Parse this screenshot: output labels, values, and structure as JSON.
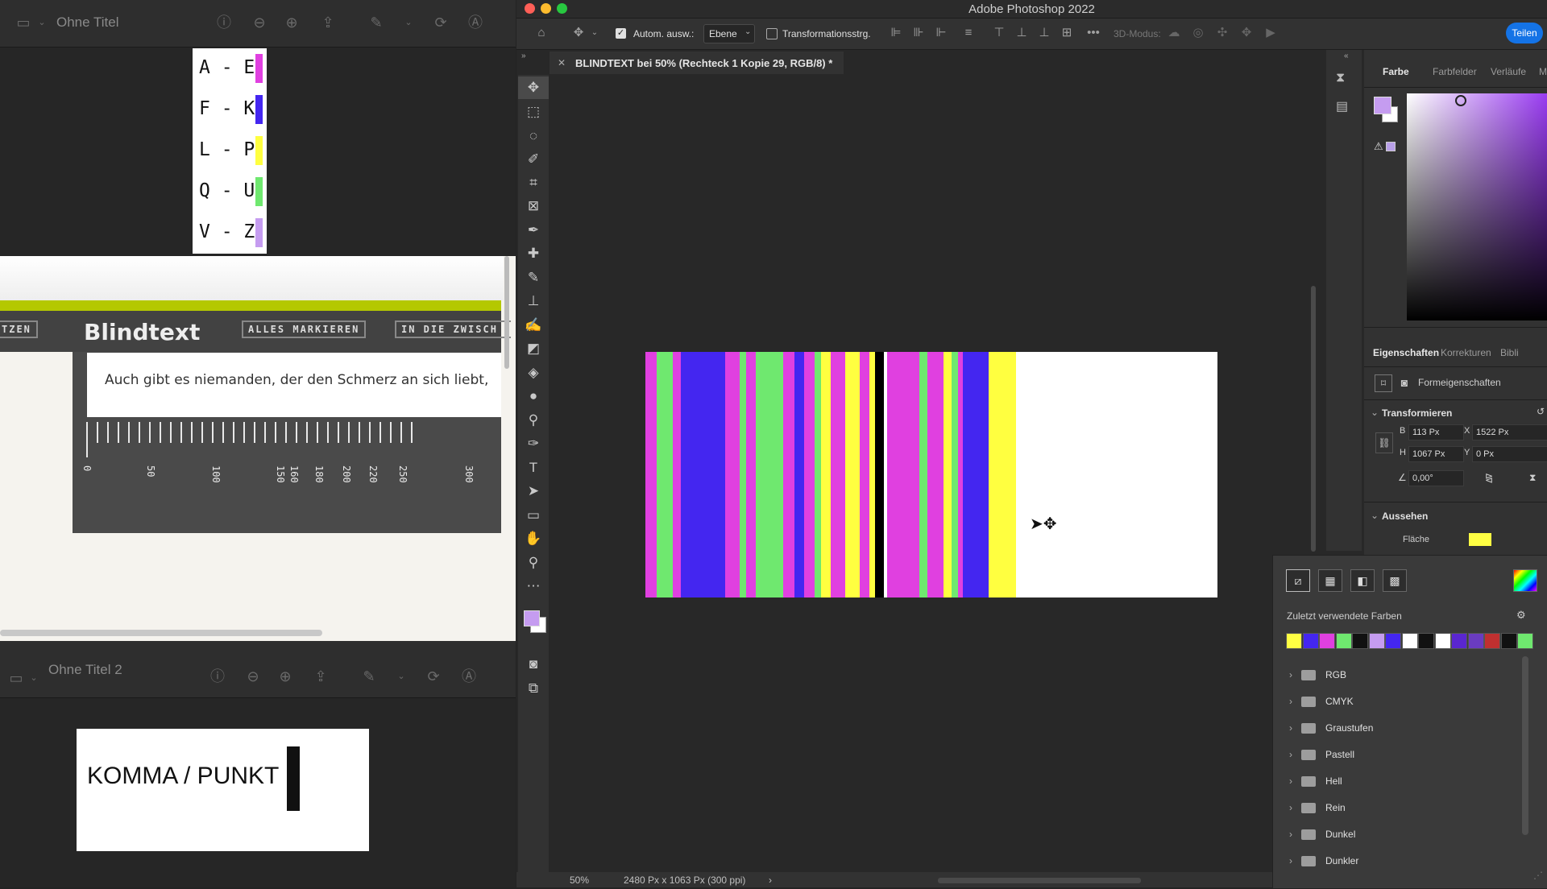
{
  "preview1": {
    "title": "Ohne Titel",
    "legend": [
      {
        "label": "A - E",
        "color": "#e040e0"
      },
      {
        "label": "F - K",
        "color": "#4426f0"
      },
      {
        "label": "L - P",
        "color": "#ffff40"
      },
      {
        "label": "Q - U",
        "color": "#6fe86f"
      },
      {
        "label": "V - Z",
        "color": "#c59cf0"
      }
    ]
  },
  "blindtext": {
    "left_button": "TZEN",
    "heading": "Blindtext",
    "btn_select_all": "ALLES MARKIEREN",
    "btn_clipboard": "IN DIE ZWISCH",
    "input_text": "Auch gibt es niemanden, der den Schmerz an sich liebt,",
    "ruler_labels": [
      "0",
      "50",
      "100",
      "150",
      "160",
      "180",
      "200",
      "220",
      "250",
      "300"
    ]
  },
  "preview2": {
    "title": "Ohne Titel 2",
    "card_text": "KOMMA / PUNKT"
  },
  "photoshop": {
    "app_title": "Adobe Photoshop 2022",
    "options": {
      "auto_select": "Autom. ausw.:",
      "layer_select": "Ebene",
      "transform_controls": "Transformationsstrg.",
      "mode_3d": "3D-Modus:",
      "share": "Teilen"
    },
    "document_tab": "BLINDTEXT bei 50% (Rechteck 1 Kopie 29, RGB/8) *",
    "status": {
      "zoom": "50%",
      "doc_size": "2480 Px x 1063 Px (300 ppi)"
    },
    "color_panel": {
      "tabs": [
        "Farbe",
        "Farbfelder",
        "Verläufe",
        "M"
      ],
      "foreground": "#c59cf0",
      "background": "#ffffff"
    },
    "properties": {
      "tabs": [
        "Eigenschaften",
        "Korrekturen",
        "Bibli"
      ],
      "shape_label": "Formeigenschaften",
      "transform_heading": "Transformieren",
      "B_label": "B",
      "B_value": "113 Px",
      "X_label": "X",
      "X_value": "1522 Px",
      "H_label": "H",
      "H_value": "1067 Px",
      "Y_label": "Y",
      "Y_value": "0 Px",
      "angle": "0,00°",
      "appearance_heading": "Aussehen",
      "fill_label": "Fläche",
      "fill_color": "#ffff43"
    },
    "swatches_popup": {
      "recent_label": "Zuletzt verwendete Farben",
      "recent_colors": [
        "#ffff43",
        "#4426f0",
        "#e040e0",
        "#6fe86f",
        "#111111",
        "#c59cf0",
        "#4426f0",
        "#ffffff",
        "#111111",
        "#ffffff",
        "#5a26d0",
        "#6a3cc0",
        "#c03030",
        "#111111",
        "#6fe86f"
      ],
      "groups": [
        "RGB",
        "CMYK",
        "Graustufen",
        "Pastell",
        "Hell",
        "Rein",
        "Dunkel",
        "Dunkler"
      ]
    },
    "canvas_stripe_colors": {
      "magenta": "#e040e0",
      "green": "#6fe86f",
      "blue": "#4426f0",
      "yellow": "#ffff40",
      "black": "#000000",
      "white": "#ffffff"
    }
  }
}
